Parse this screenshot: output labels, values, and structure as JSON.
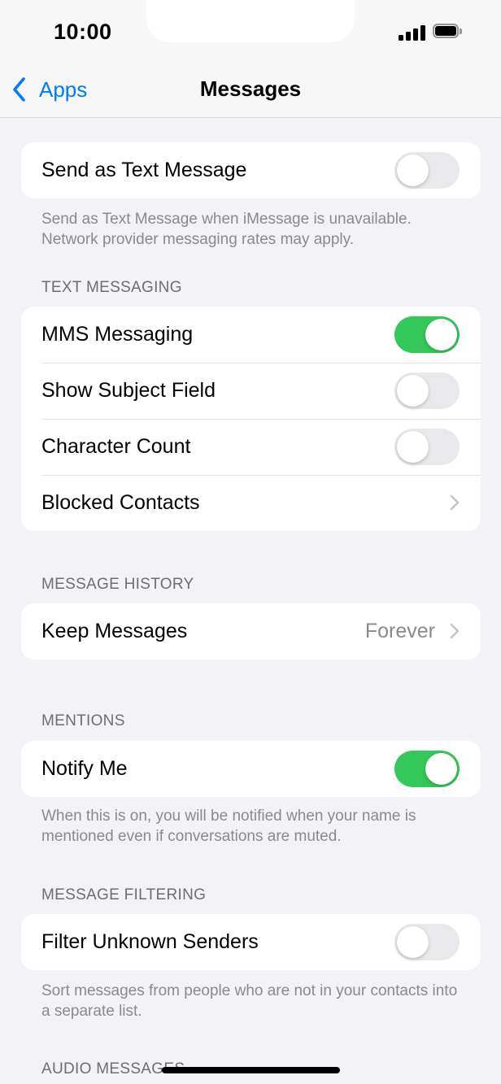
{
  "status_bar": {
    "time": "10:00"
  },
  "nav": {
    "back_label": "Apps",
    "title": "Messages"
  },
  "send_as_text": {
    "label": "Send as Text Message",
    "enabled": false,
    "footer": "Send as Text Message when iMessage is unavailable. Network provider messaging rates may apply."
  },
  "text_messaging": {
    "header": "TEXT MESSAGING",
    "rows": [
      {
        "label": "MMS Messaging",
        "enabled": true
      },
      {
        "label": "Show Subject Field",
        "enabled": false
      },
      {
        "label": "Character Count",
        "enabled": false
      },
      {
        "label": "Blocked Contacts"
      }
    ]
  },
  "message_history": {
    "header": "MESSAGE HISTORY",
    "keep_label": "Keep Messages",
    "keep_value": "Forever"
  },
  "mentions": {
    "header": "MENTIONS",
    "label": "Notify Me",
    "enabled": true,
    "footer": "When this is on, you will be notified when your name is mentioned even if conversations are muted."
  },
  "message_filtering": {
    "header": "MESSAGE FILTERING",
    "label": "Filter Unknown Senders",
    "enabled": false,
    "footer": "Sort messages from people who are not in your contacts into a separate list."
  },
  "audio_messages": {
    "header": "AUDIO MESSAGES"
  },
  "colors": {
    "accent": "#007aff",
    "toggle_on": "#34c759",
    "toggle_off": "#e9e9eb",
    "background": "#f2f2f7"
  }
}
